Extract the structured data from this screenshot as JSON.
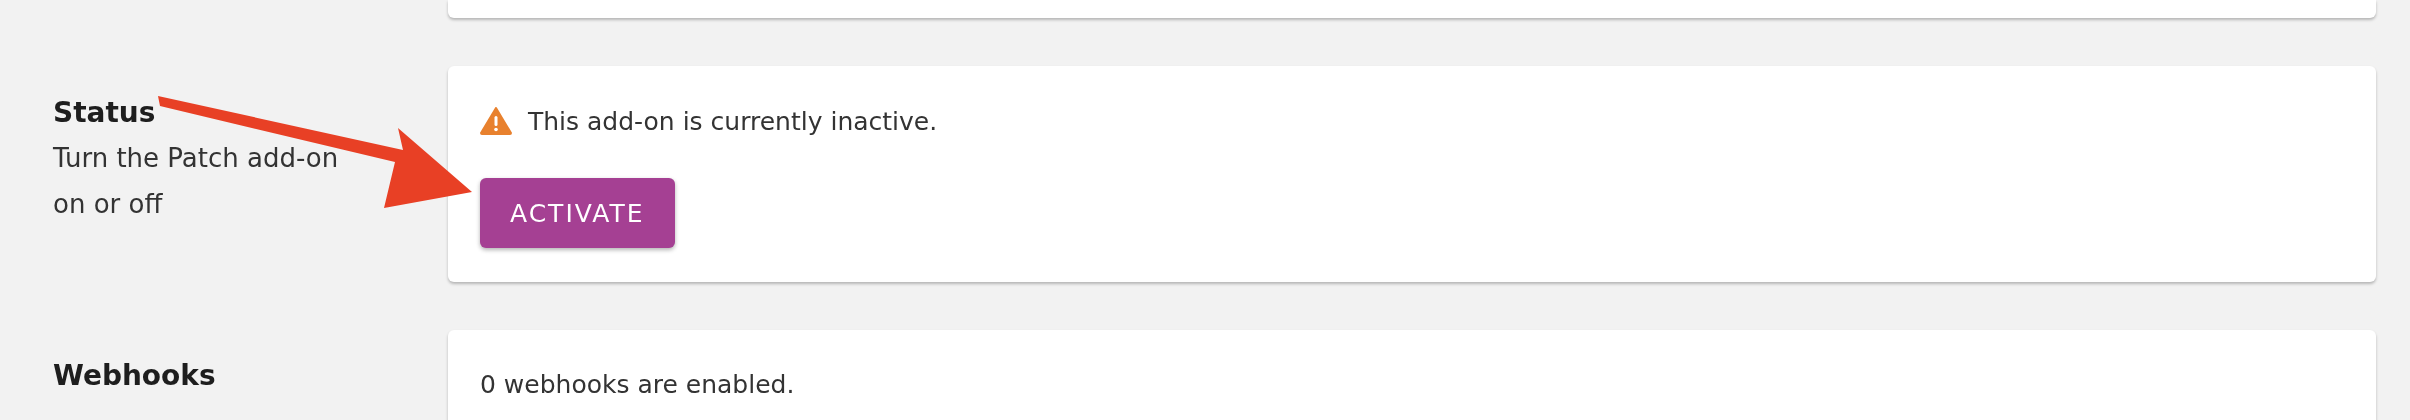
{
  "sections": [
    {
      "title": "Status",
      "description": "Turn the Patch add-on on or off",
      "notice": {
        "kind": "warning",
        "text": "This add-on is currently inactive."
      },
      "button": {
        "label": "ACTIVATE"
      }
    },
    {
      "title": "Webhooks",
      "message": "0 webhooks are enabled."
    }
  ],
  "annotation": {
    "kind": "arrow"
  }
}
